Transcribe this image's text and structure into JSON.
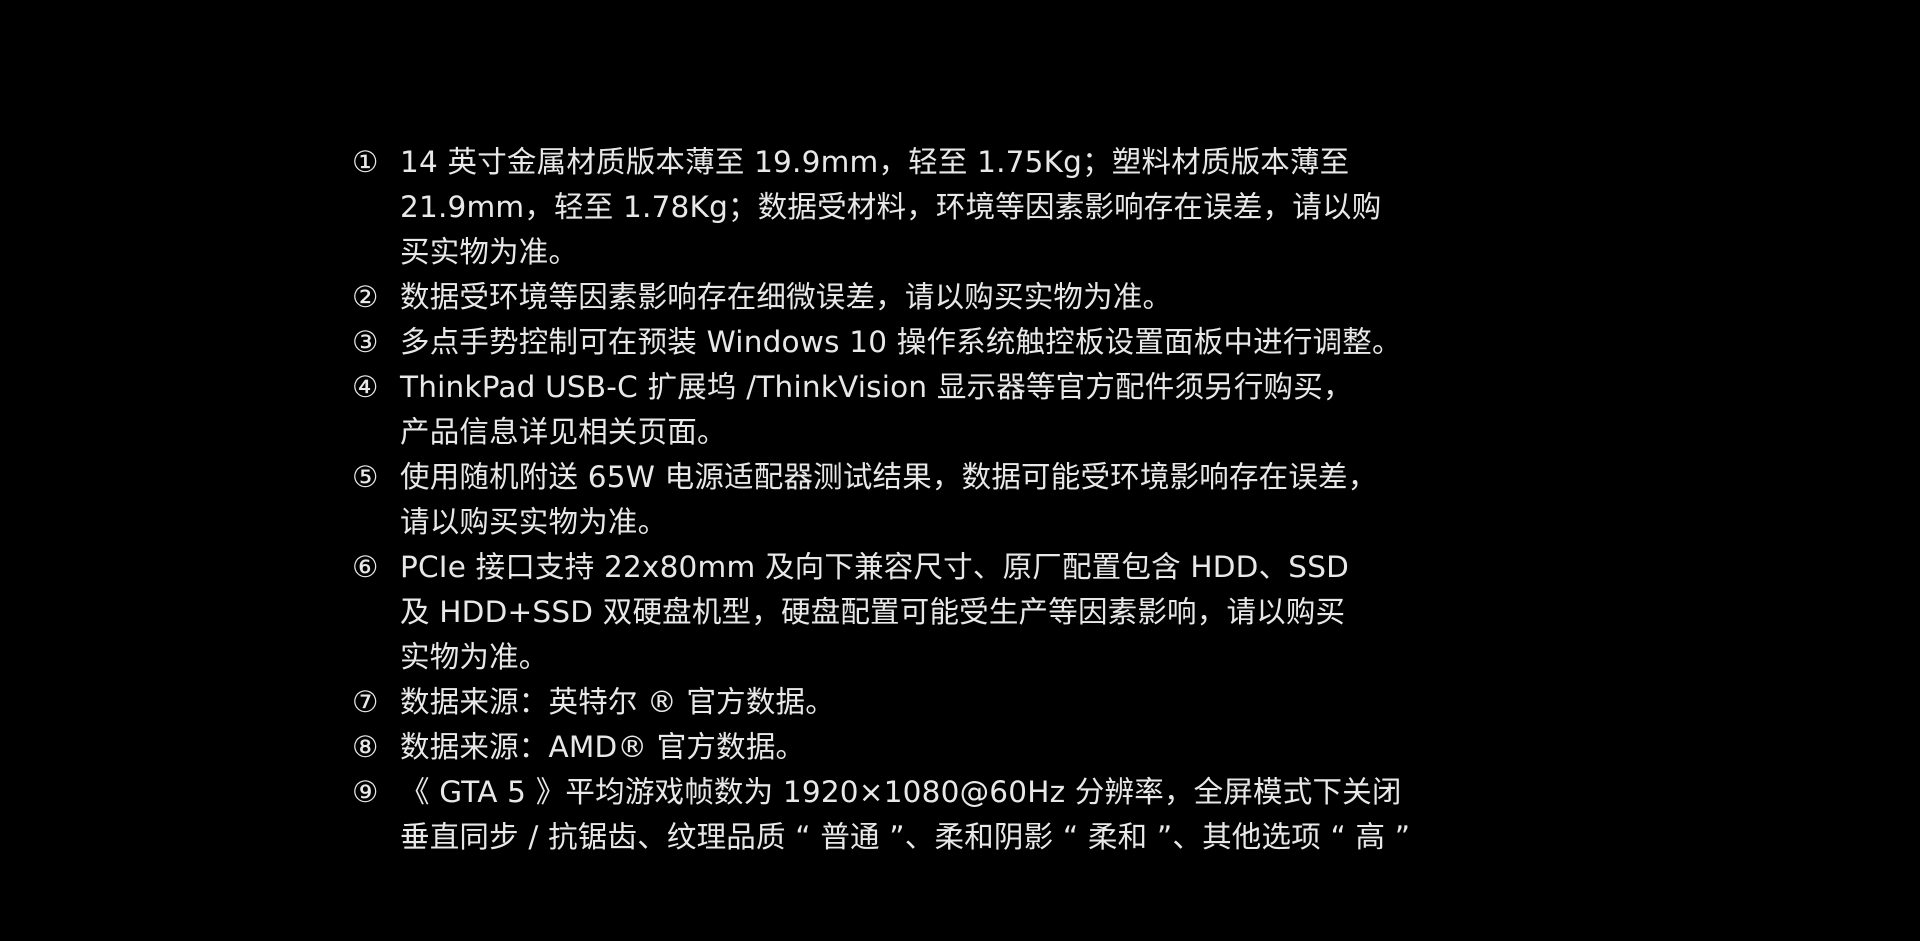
{
  "notes": [
    {
      "mark": "①",
      "lines": [
        "14 英寸金属材质版本薄至 19.9mm，轻至 1.75Kg；塑料材质版本薄至",
        "21.9mm，轻至 1.78Kg；数据受材料，环境等因素影响存在误差，请以购",
        "买实物为准。"
      ]
    },
    {
      "mark": "②",
      "lines": [
        "数据受环境等因素影响存在细微误差，请以购买实物为准。"
      ]
    },
    {
      "mark": "③",
      "lines": [
        "多点手势控制可在预装 Windows 10 操作系统触控板设置面板中进行调整。"
      ]
    },
    {
      "mark": "④",
      "lines": [
        "ThinkPad USB-C 扩展坞 /ThinkVision 显示器等官方配件须另行购买，",
        "产品信息详见相关页面。"
      ]
    },
    {
      "mark": "⑤",
      "lines": [
        "使用随机附送 65W 电源适配器测试结果，数据可能受环境影响存在误差，",
        "请以购买实物为准。"
      ]
    },
    {
      "mark": "⑥",
      "lines": [
        "PCIe 接口支持 22x80mm 及向下兼容尺寸、原厂配置包含 HDD、SSD",
        "及 HDD+SSD 双硬盘机型，硬盘配置可能受生产等因素影响，请以购买",
        "实物为准。"
      ]
    },
    {
      "mark": "⑦",
      "lines": [
        "数据来源：英特尔 ® 官方数据。"
      ]
    },
    {
      "mark": "⑧",
      "lines": [
        "数据来源：AMD® 官方数据。"
      ]
    },
    {
      "mark": "⑨",
      "lines": [
        "《 GTA  5 》平均游戏帧数为 1920×1080@60Hz 分辨率，全屏模式下关闭",
        "垂直同步 / 抗锯齿、纹理品质 “ 普通 ”、柔和阴影 “ 柔和 ”、其他选项 “ 高 ”"
      ]
    }
  ]
}
